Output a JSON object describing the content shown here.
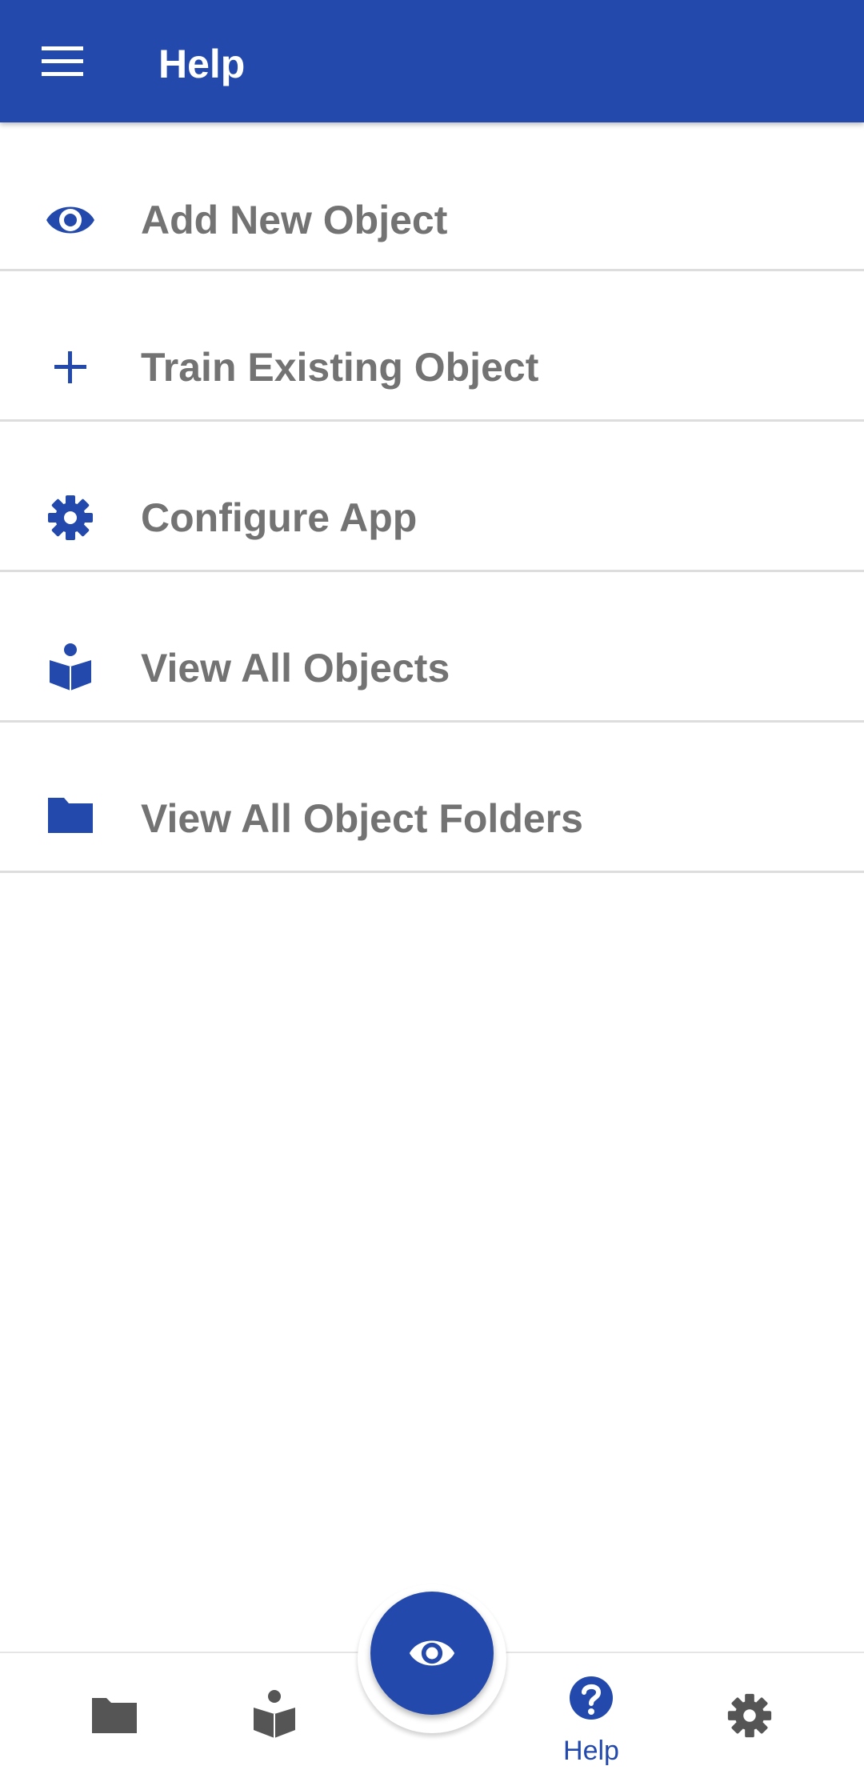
{
  "appbar": {
    "title": "Help",
    "menu_icon": "hamburger-menu-icon",
    "background": "#2249ab"
  },
  "help_items": [
    {
      "label": "Add New Object",
      "icon": "eye-icon"
    },
    {
      "label": "Train Existing Object",
      "icon": "plus-icon"
    },
    {
      "label": "Configure App",
      "icon": "gear-icon"
    },
    {
      "label": "View All Objects",
      "icon": "reader-icon"
    },
    {
      "label": "View All Object Folders",
      "icon": "folder-icon"
    }
  ],
  "bottom_nav": {
    "items": [
      {
        "icon": "folder-icon",
        "label": ""
      },
      {
        "icon": "reader-icon",
        "label": ""
      },
      {
        "icon": "help-circle-icon",
        "label": "Help",
        "active": true
      },
      {
        "icon": "gear-icon",
        "label": ""
      }
    ],
    "fab_icon": "eye-icon"
  },
  "colors": {
    "accent": "#2249ab",
    "label_gray": "#737373",
    "inactive_icon": "#555555",
    "divider": "#dddddd"
  }
}
